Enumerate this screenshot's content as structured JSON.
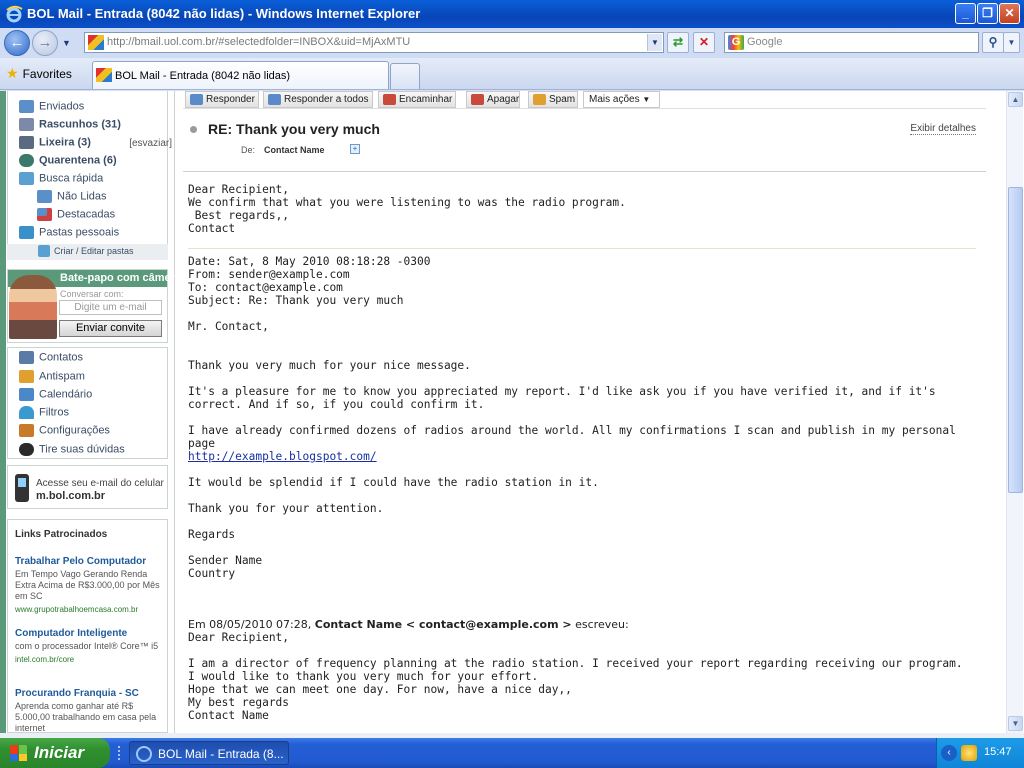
{
  "window": {
    "title": "BOL Mail - Entrada (8042 não lidas) - Windows Internet Explorer",
    "minimize_label": "_",
    "maximize_label": "❐",
    "close_label": "✕"
  },
  "address": {
    "url": "http://bmail.uol.com.br/#selectedfolder=INBOX&uid=MjAxMTU",
    "search_placeholder": "Google",
    "back_icon": "back-arrow-icon",
    "forward_icon": "forward-arrow-icon",
    "refresh_icon": "refresh-icon",
    "stop_icon": "stop-icon",
    "search_icon": "magnifier-icon"
  },
  "favorites": {
    "label": "Favorites",
    "tab_label": "BOL Mail - Entrada (8042 não lidas)"
  },
  "sidebar": {
    "folders": [
      {
        "label": "Enviados",
        "bold": false,
        "indent": 0,
        "color": "#5b8fc8"
      },
      {
        "label": "Rascunhos (31)",
        "bold": true,
        "indent": 0,
        "color": "#7a8aa8"
      },
      {
        "label": "Lixeira (3)",
        "bold": true,
        "indent": 0,
        "side": "[esvaziar]",
        "color": "#5a6a80"
      },
      {
        "label": "Quarentena (6)",
        "bold": true,
        "indent": 0,
        "color": "#3a7a6a"
      },
      {
        "label": "Busca rápida",
        "bold": false,
        "indent": 0,
        "color": "#5aa0d0"
      },
      {
        "label": "Não Lidas",
        "bold": false,
        "indent": 1,
        "color": "#5b8fc8"
      },
      {
        "label": "Destacadas",
        "bold": false,
        "indent": 1,
        "color": "#d04040"
      },
      {
        "label": "Pastas pessoais",
        "bold": false,
        "indent": 0,
        "color": "#3a90c8"
      }
    ],
    "create_folders": "Criar / Editar pastas",
    "chat": {
      "title": "Bate-papo com câmera",
      "subtitle": "Conversar com:",
      "email_placeholder": "Digite um e-mail",
      "send_button": "Enviar convite"
    },
    "tools": [
      {
        "label": "Contatos",
        "color": "#5a7aa8"
      },
      {
        "label": "Antispam",
        "color": "#e0a030"
      },
      {
        "label": "Calendário",
        "color": "#4a88c8"
      },
      {
        "label": "Filtros",
        "color": "#3a9ad0"
      },
      {
        "label": "Configurações",
        "color": "#c87a2a"
      },
      {
        "label": "Tire suas dúvidas",
        "color": "#2a2a2a"
      }
    ],
    "mobile": {
      "line1": "Acesse seu e-mail do celular",
      "line2": "m.bol.com.br"
    },
    "links_header": "Links Patrocinados",
    "ads": [
      {
        "title": "Trabalhar Pelo Computador",
        "desc": "Em Tempo Vago Gerando Renda Extra Acima de R$3.000,00 por Mês em SC",
        "url": "www.grupotrabalhoemcasa.com.br"
      },
      {
        "title": "Computador Inteligente",
        "desc": "com o processador Intel® Core™ i5",
        "url": "intel.com.br/core"
      },
      {
        "title": "Procurando Franquia - SC",
        "desc": "Aprenda como ganhar até R$ 5.000,00 trabalhando em casa pela internet",
        "url": ""
      }
    ]
  },
  "toolbar": {
    "buttons": [
      {
        "label": "Responder",
        "color": "#5a8ac8"
      },
      {
        "label": "Responder a todos",
        "color": "#5a8ac8"
      },
      {
        "label": "Encaminhar",
        "color": "#c84a3a"
      },
      {
        "label": "Apagar",
        "color": "#c84a3a"
      },
      {
        "label": "Spam",
        "color": "#e0a030"
      }
    ],
    "more_actions": "Mais ações"
  },
  "message": {
    "subject": "RE: Thank you very much",
    "show_details": "Exibir detalhes",
    "from_label": "De:",
    "from_name": "Contact Name",
    "greeting": "Dear Recipient,",
    "intro": "We confirm that what you were listening to was the radio program.",
    "regards": " Best regards,,",
    "sender_sign": "Contact",
    "quoted_date": "Date: Sat, 8 May 2010 08:18:28 -0300",
    "quoted_from": "From: sender@example.com",
    "quoted_to": "To: contact@example.com",
    "quoted_subject": "Subject: Re: Thank you very much",
    "quoted_salutation": "Mr. Contact,",
    "para1": "Thank you very much for your nice message.",
    "para2": "It's a pleasure for me to know you appreciated my report. I'd like ask you if you have verified it, and if it's correct. And if so, if you could confirm it.",
    "para3": "I have already confirmed dozens of radios around the world. All my confirmations I scan and publish in my personal page",
    "link": "http://example.blogspot.com/",
    "para4": "It would be splendid if I could have the radio station in it.",
    "para5": "Thank you for your attention.",
    "closing": "Regards",
    "signature_name": "Sender Name",
    "signature_country": "Country",
    "wrote_prefix": "Em 08/05/2010 07:28, ",
    "wrote_name": "Contact Name < contact@example.com >",
    "wrote_suffix": " escreveu:",
    "orig_greeting": "Dear Recipient,",
    "orig_para1": "I am a director of frequency planning at the radio station. I received your report regarding receiving our program.",
    "orig_para2": "I would like to thank you very much for your effort.",
    "orig_para3": "Hope that we can meet one day. For now, have a nice day,,",
    "orig_regards": "My best regards",
    "orig_name": "Contact Name"
  },
  "taskbar": {
    "start_label": "Iniciar",
    "task_label": "BOL Mail - Entrada (8...",
    "clock": "15:47"
  }
}
